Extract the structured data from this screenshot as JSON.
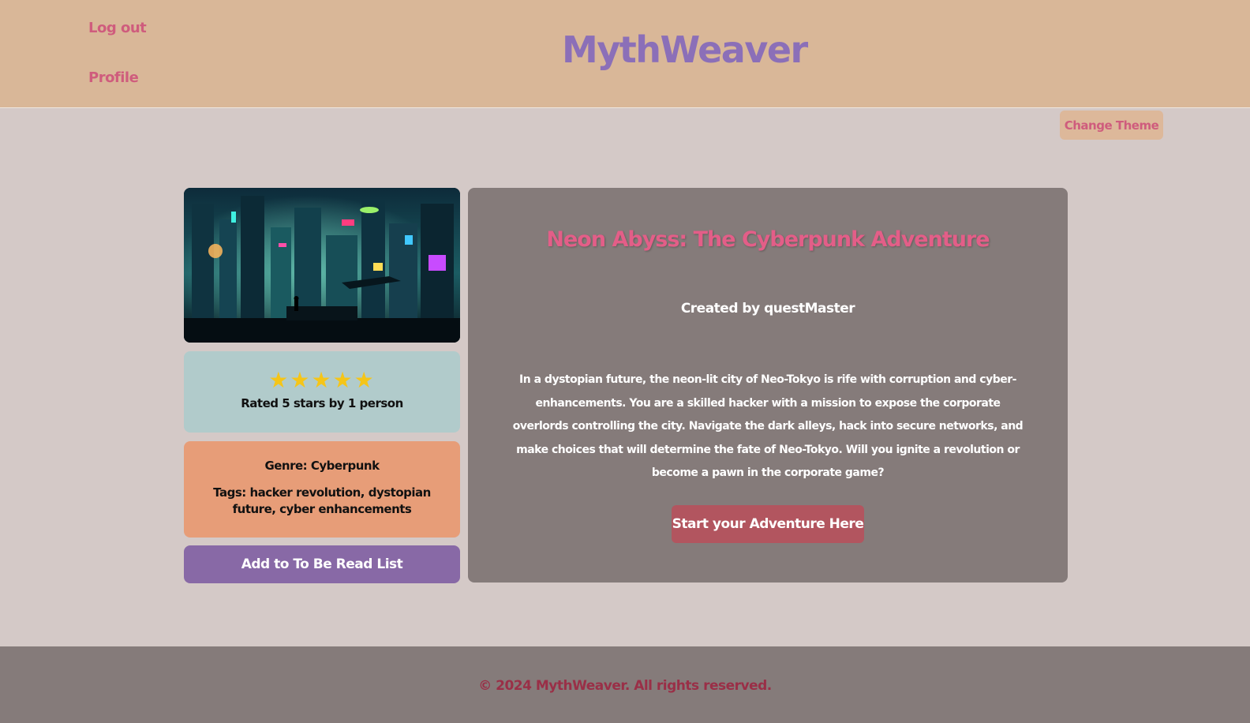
{
  "header": {
    "logout_label": "Log out",
    "profile_label": "Profile",
    "brand": "MythWeaver"
  },
  "theme": {
    "button_label": "Change Theme"
  },
  "sidebar": {
    "stars": "★★★★★",
    "rating_text": "Rated 5 stars by 1 person",
    "rating_value": 5,
    "genre": "Genre: Cyberpunk",
    "tags": "Tags: hacker revolution, dystopian future, cyber enhancements",
    "tbr_label": "Add to To Be Read List"
  },
  "story": {
    "title": "Neon Abyss: The Cyberpunk Adventure",
    "creator": "Created by questMaster",
    "description": "In a dystopian future, the neon-lit city of Neo-Tokyo is rife with corruption and cyber-enhancements. You are a skilled hacker with a mission to expose the corporate overlords controlling the city. Navigate the dark alleys, hack into secure networks, and make choices that will determine the fate of Neo-Tokyo. Will you ignite a revolution or become a pawn in the corporate game?",
    "start_label": "Start your Adventure Here"
  },
  "footer": {
    "text": "© 2024 MythWeaver. All rights reserved."
  },
  "colors": {
    "header_bg": "#d9b798",
    "page_bg": "#d4c9c7",
    "accent_pink": "#cf5c7d",
    "brand_purple": "#8b6fb8",
    "rating_card": "#b1cbcb",
    "genre_card": "#e79d78",
    "tbr_button": "#8869a6",
    "main_card": "#857b7a",
    "start_button": "#b2555f",
    "star": "#f5c518"
  }
}
